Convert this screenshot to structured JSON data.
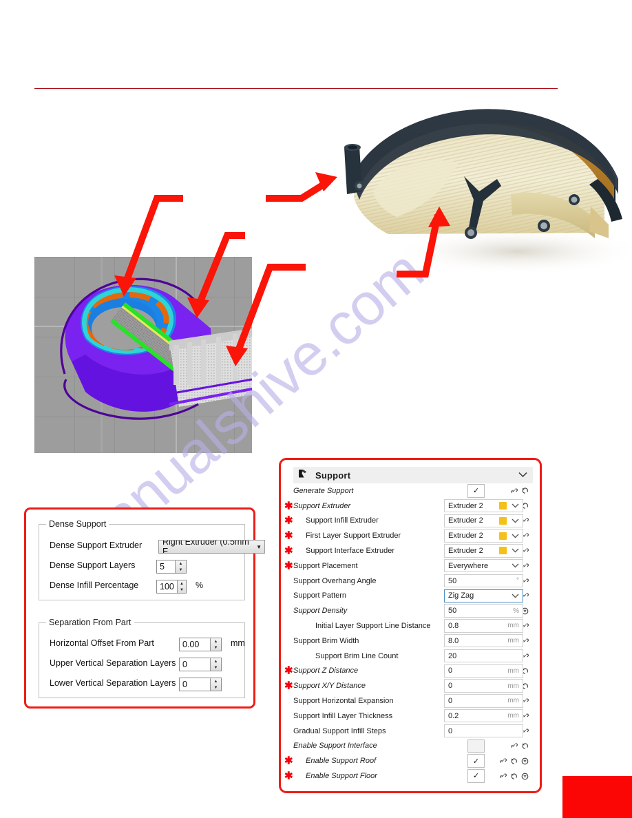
{
  "watermark": {
    "text": "manualshive.com"
  },
  "photo": {
    "alt": "3d-printed-curved-part-with-support-material"
  },
  "viewport": {
    "alt": "slicer-preview-support-structures"
  },
  "dense_support_dialog": {
    "groups": [
      {
        "title": "Dense Support",
        "fields": [
          {
            "label": "Dense Support Extruder",
            "type": "combo",
            "value": "Right Extruder (0.5mm E",
            "unit": ""
          },
          {
            "label": "Dense Support Layers",
            "type": "spinner",
            "value": "5",
            "unit": ""
          },
          {
            "label": "Dense Infill Percentage",
            "type": "spinner",
            "value": "100",
            "unit": "%"
          }
        ]
      },
      {
        "title": "Separation From Part",
        "fields": [
          {
            "label": "Horizontal Offset From Part",
            "type": "spinner",
            "value": "0.00",
            "unit": "mm"
          },
          {
            "label": "Upper Vertical Separation Layers",
            "type": "spinner",
            "value": "0",
            "unit": ""
          },
          {
            "label": "Lower Vertical Separation Layers",
            "type": "spinner",
            "value": "0",
            "unit": ""
          }
        ]
      }
    ]
  },
  "support_panel": {
    "header": {
      "title": "Support",
      "icon": "support-blocker-icon",
      "collapse_icon": "chevron-down-icon"
    },
    "rows": [
      {
        "label": "Generate Support",
        "indent": 0,
        "italic": true,
        "star": false,
        "icons": [
          "link",
          "revert"
        ],
        "control": "check",
        "value": "✓",
        "unit": ""
      },
      {
        "label": "Support Extruder",
        "indent": 0,
        "italic": true,
        "star": true,
        "icons": [
          "link",
          "revert"
        ],
        "control": "dropdown",
        "value": "Extruder 2",
        "unit": "",
        "swatch": "#f5c018"
      },
      {
        "label": "Support Infill Extruder",
        "indent": 1,
        "italic": false,
        "star": true,
        "icons": [
          "link"
        ],
        "control": "dropdown",
        "value": "Extruder 2",
        "unit": "",
        "swatch": "#f5c018"
      },
      {
        "label": "First Layer Support Extruder",
        "indent": 1,
        "italic": false,
        "star": true,
        "icons": [
          "link"
        ],
        "control": "dropdown",
        "value": "Extruder 2",
        "unit": "",
        "swatch": "#f5c018"
      },
      {
        "label": "Support Interface Extruder",
        "indent": 1,
        "italic": false,
        "star": true,
        "icons": [
          "link"
        ],
        "control": "dropdown",
        "value": "Extruder 2",
        "unit": "",
        "swatch": "#f5c018"
      },
      {
        "label": "Support Placement",
        "indent": 0,
        "italic": false,
        "star": true,
        "icons": [
          "link"
        ],
        "control": "select",
        "value": "Everywhere",
        "unit": ""
      },
      {
        "label": "Support Overhang Angle",
        "indent": 0,
        "italic": false,
        "star": false,
        "icons": [
          "link"
        ],
        "control": "text",
        "value": "50",
        "unit": "°"
      },
      {
        "label": "Support Pattern",
        "indent": 0,
        "italic": false,
        "star": false,
        "icons": [
          "link"
        ],
        "control": "select",
        "value": "Zig Zag",
        "unit": "",
        "focused": true
      },
      {
        "label": "Support Density",
        "indent": 0,
        "italic": true,
        "star": false,
        "icons": [
          "link",
          "revert",
          "calc"
        ],
        "control": "text",
        "value": "50",
        "unit": "%"
      },
      {
        "label": "Initial Layer Support Line Distance",
        "indent": 2,
        "italic": false,
        "star": false,
        "icons": [
          "link"
        ],
        "control": "text",
        "value": "0.8",
        "unit": "mm"
      },
      {
        "label": "Support Brim Width",
        "indent": 0,
        "italic": false,
        "star": false,
        "icons": [
          "link"
        ],
        "control": "text",
        "value": "8.0",
        "unit": "mm"
      },
      {
        "label": "Support Brim Line Count",
        "indent": 2,
        "italic": false,
        "star": false,
        "icons": [
          "link"
        ],
        "control": "text",
        "value": "20",
        "unit": ""
      },
      {
        "label": "Support Z Distance",
        "indent": 0,
        "italic": true,
        "star": true,
        "icons": [
          "link",
          "revert"
        ],
        "control": "text",
        "value": "0",
        "unit": "mm"
      },
      {
        "label": "Support X/Y Distance",
        "indent": 0,
        "italic": true,
        "star": true,
        "icons": [
          "link",
          "revert"
        ],
        "control": "text",
        "value": "0",
        "unit": "mm"
      },
      {
        "label": "Support Horizontal Expansion",
        "indent": 0,
        "italic": false,
        "star": false,
        "icons": [
          "link"
        ],
        "control": "text",
        "value": "0",
        "unit": "mm"
      },
      {
        "label": "Support Infill Layer Thickness",
        "indent": 0,
        "italic": false,
        "star": false,
        "icons": [
          "link"
        ],
        "control": "text",
        "value": "0.2",
        "unit": "mm"
      },
      {
        "label": "Gradual Support Infill Steps",
        "indent": 0,
        "italic": false,
        "star": false,
        "icons": [
          "link"
        ],
        "control": "text",
        "value": "0",
        "unit": ""
      },
      {
        "label": "Enable Support Interface",
        "indent": 0,
        "italic": true,
        "star": false,
        "icons": [
          "link",
          "revert"
        ],
        "control": "check-empty",
        "value": "",
        "unit": ""
      },
      {
        "label": "Enable Support Roof",
        "indent": 1,
        "italic": true,
        "star": true,
        "icons": [
          "link",
          "revert",
          "calc"
        ],
        "control": "check",
        "value": "✓",
        "unit": ""
      },
      {
        "label": "Enable Support Floor",
        "indent": 1,
        "italic": true,
        "star": true,
        "icons": [
          "link",
          "revert",
          "calc"
        ],
        "control": "check",
        "value": "✓",
        "unit": ""
      }
    ]
  },
  "colors": {
    "callout_red": "#ee1c16",
    "arrow_red": "#fb1408",
    "rule_red": "#aa0a14",
    "extruder_swatch": "#f5c018",
    "focus_blue": "#4a90c4",
    "watermark": "#b9b1e8"
  }
}
